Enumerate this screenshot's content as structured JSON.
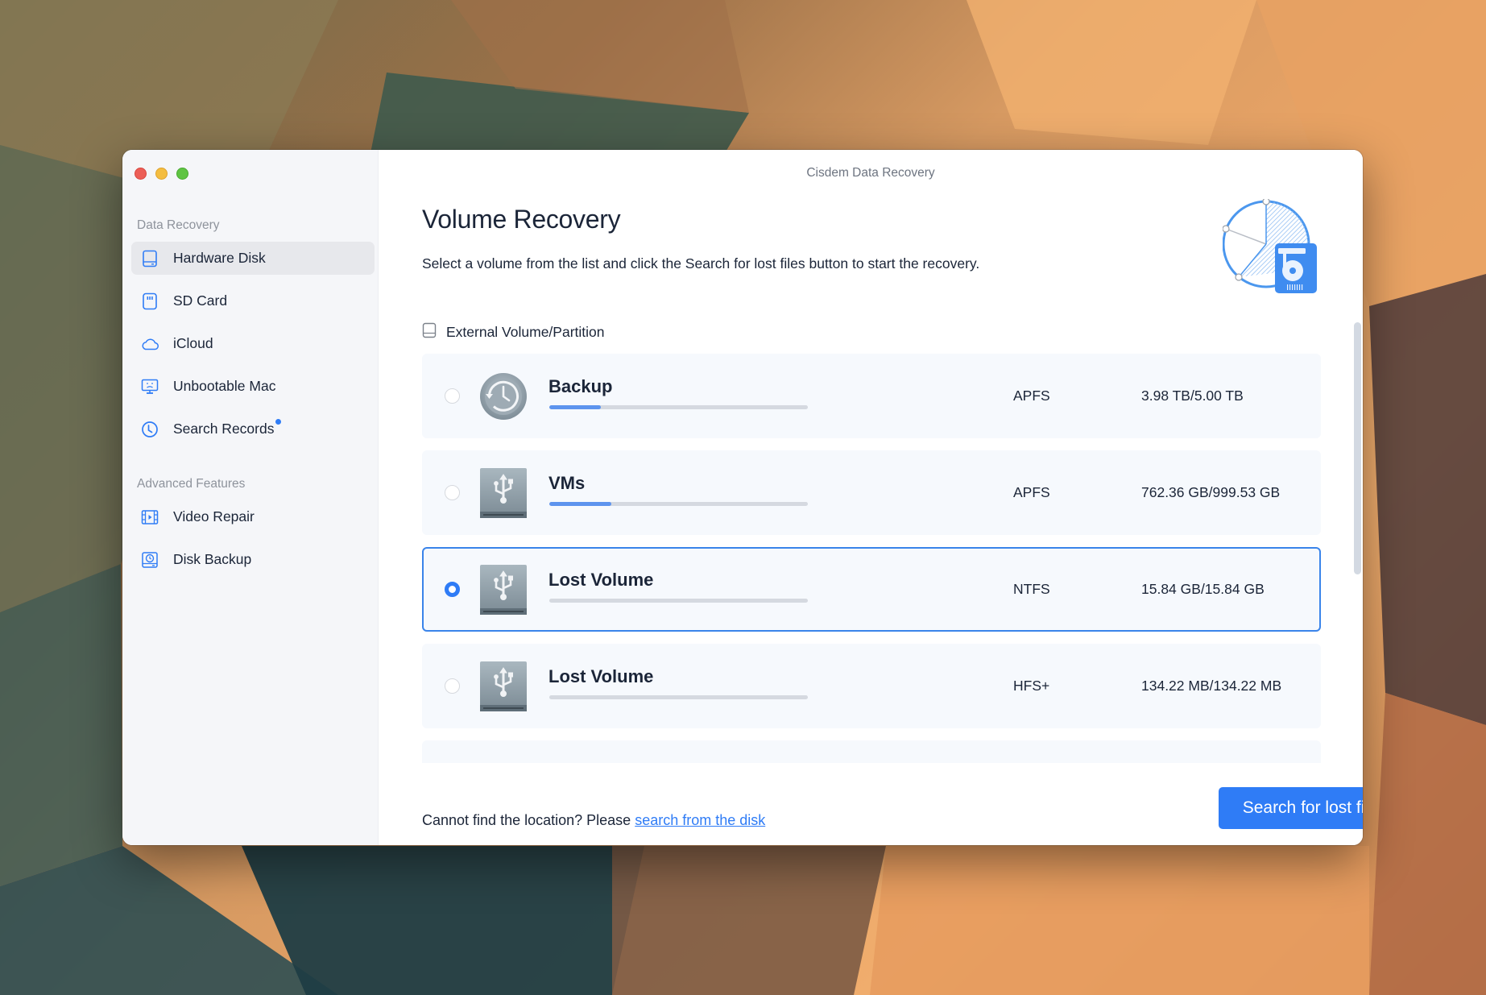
{
  "window": {
    "title": "Cisdem Data Recovery"
  },
  "sidebar": {
    "sections": [
      {
        "label": "Data Recovery",
        "items": [
          {
            "label": "Hardware Disk",
            "icon": "hard-disk-icon",
            "active": true
          },
          {
            "label": "SD Card",
            "icon": "sd-card-icon",
            "active": false
          },
          {
            "label": "iCloud",
            "icon": "cloud-icon",
            "active": false
          },
          {
            "label": "Unbootable Mac",
            "icon": "sad-monitor-icon",
            "active": false
          },
          {
            "label": "Search Records",
            "icon": "clock-icon",
            "active": false,
            "badge_dot": true
          }
        ]
      },
      {
        "label": "Advanced Features",
        "items": [
          {
            "label": "Video Repair",
            "icon": "film-icon",
            "active": false
          },
          {
            "label": "Disk Backup",
            "icon": "disk-backup-icon",
            "active": false
          }
        ]
      }
    ]
  },
  "main": {
    "title": "Volume Recovery",
    "description": "Select a volume from the list and click the Search for lost files button to start the recovery.",
    "list_header": "External Volume/Partition",
    "volumes": [
      {
        "name": "Backup",
        "icon": "time-machine-icon",
        "filesystem": "APFS",
        "size": "3.98 TB/5.00 TB",
        "usage_fraction": 0.2,
        "selected": false
      },
      {
        "name": "VMs",
        "icon": "usb-drive-icon",
        "filesystem": "APFS",
        "size": "762.36 GB/999.53 GB",
        "usage_fraction": 0.24,
        "selected": false
      },
      {
        "name": "Lost Volume",
        "icon": "usb-drive-icon",
        "filesystem": "NTFS",
        "size": "15.84 GB/15.84 GB",
        "usage_fraction": 0,
        "selected": true
      },
      {
        "name": "Lost Volume",
        "icon": "usb-drive-icon",
        "filesystem": "HFS+",
        "size": "134.22 MB/134.22 MB",
        "usage_fraction": 0,
        "selected": false
      }
    ],
    "footer": {
      "prompt": "Cannot find the location? Please ",
      "link": "search from the disk"
    },
    "primary_button": {
      "label": "Search for lost files",
      "icon": "arrow-right-icon"
    }
  },
  "colors": {
    "accent": "#2f7cf6",
    "selected_border": "#3a84ea",
    "row_background": "#f6f9fd",
    "sidebar_background": "#f5f6f9",
    "text": "#1b2538"
  }
}
